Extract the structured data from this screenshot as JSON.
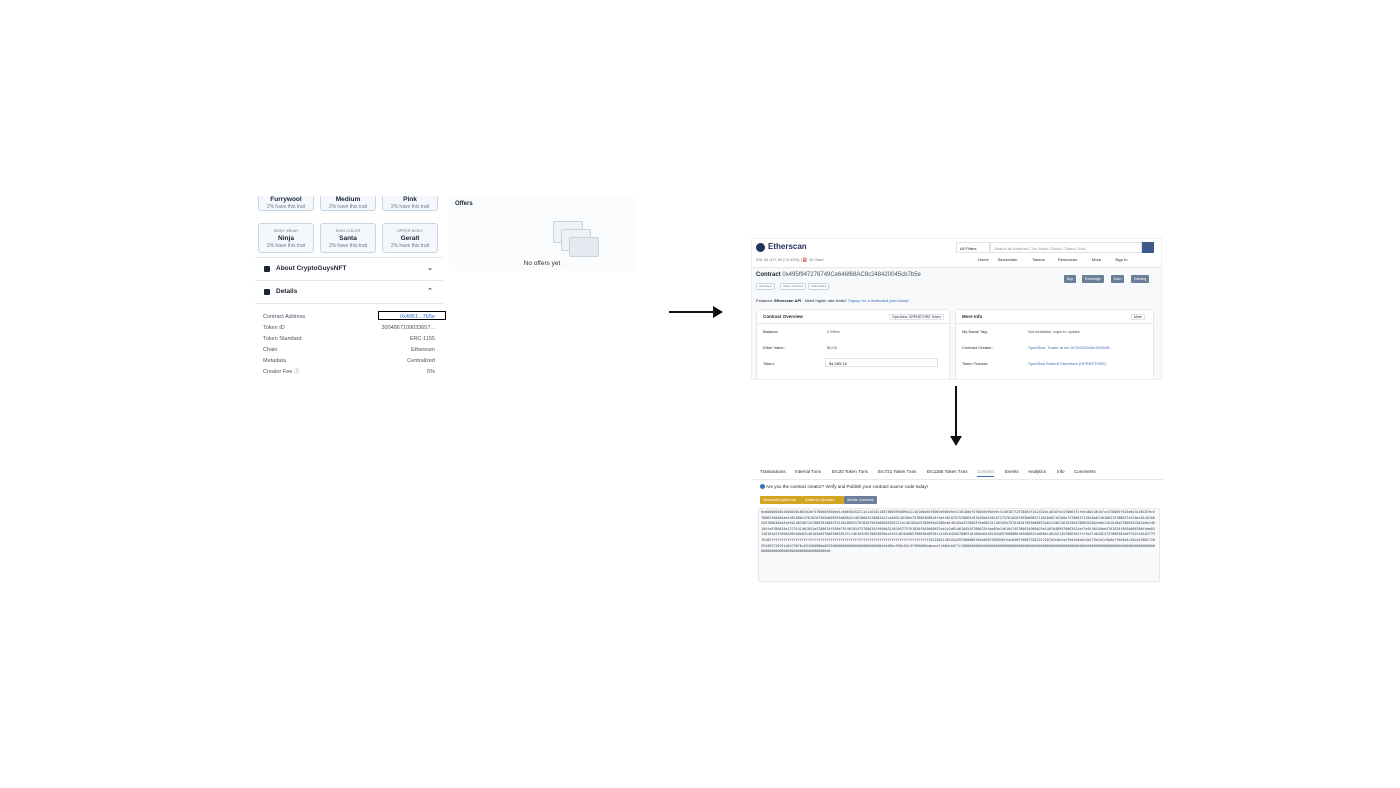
{
  "opensea": {
    "traits_row1": [
      {
        "name": "Furrywool",
        "rarity": "2% have this trait"
      },
      {
        "name": "Medium",
        "rarity": "2% have this trait"
      },
      {
        "name": "Pink",
        "rarity": "2% have this trait"
      }
    ],
    "traits_row2": [
      {
        "type": "BODY WEAR",
        "name": "Ninja",
        "rarity": "2% have this trait"
      },
      {
        "type": "SKIN COLOR",
        "name": "Santa",
        "rarity": "2% have this trait"
      },
      {
        "type": "UPPER BODY",
        "name": "Geralt",
        "rarity": "2% have this trait"
      }
    ],
    "about_label": "About CryptoGuysNFT",
    "details_label": "Details",
    "details": [
      {
        "key": "Contract Address",
        "value": "0x4951...7b5e"
      },
      {
        "key": "Token ID",
        "value": "3004867109033657..."
      },
      {
        "key": "Token Standard",
        "value": "ERC-1155"
      },
      {
        "key": "Chain",
        "value": "Ethereum"
      },
      {
        "key": "Metadata",
        "value": "Centralized"
      },
      {
        "key": "Creator Fee ⓘ",
        "value": "5%"
      }
    ],
    "offers_title": "Offers",
    "no_offers": "No offers yet"
  },
  "etherscan": {
    "logo": "Etherscan",
    "price": "Eth: $1,317.50 (+0.45%) | ⛽ 15 Gwei",
    "filter": "All Filters",
    "search_placeholder": "Search by Address / Txn Hash / Block / Token / Ens",
    "nav": [
      "Home",
      "Blockchain",
      "Tokens",
      "Resources",
      "More",
      "Sign In"
    ],
    "contract_label": "Contract",
    "contract_address": "0x495f947276749Ce646f68AC8c248420045cb7b5e",
    "tags": [
      "OpenSea",
      "Token Contract",
      "Collectibles"
    ],
    "right_buttons": [
      "Buy",
      "Exchange",
      "Earn",
      "Gaming"
    ],
    "featured_label": "Featured:",
    "featured_bold": "Etherscan API",
    "featured_text": " - Need higher rate limits? ",
    "featured_link": "Signup for a dedicated plan today!",
    "overview_title": "Contract Overview",
    "overview_badge": "OpenSea: OPENSTORE Token",
    "balance_label": "Balance:",
    "balance_value": "0 Ether",
    "ether_value_label": "Ether Value:",
    "ether_value": "$0.00",
    "token_label": "Token:",
    "token_value": "$4,085.16",
    "moreinfo_title": "More Info",
    "more_btn": "More",
    "name_tag_label": "My Name Tag:",
    "name_tag_value": "Not Available, login to update",
    "creator_label": "Contract Creator:",
    "creator_value": "OpenSea: Trader at txn 0x7b9312d5e7b53cf5...",
    "tracker_label": "Token Tracker:",
    "tracker_value": "OpenSea Shared Storefront (OPENSTORE)"
  },
  "contract_tab": {
    "tabs": [
      "Transactions",
      "Internal Txns",
      "Erc20 Token Txns",
      "Erc721 Token Txns",
      "Erc1155 Token Txns",
      "Contract",
      "Events",
      "Analytics",
      "Info",
      "Comments"
    ],
    "active_tab": "Contract",
    "verify_text": "Are you the contract creator? Verify and Publish your contract source code today!",
    "buttons": [
      "Decompile ByteCode",
      "Switch to Opcodes View",
      "Similar Contracts"
    ],
    "bytecode": "0x60806040526004361061020f5760003560e01c80636352211e1161011857806395d89b41116100a0578063e985e9c51161006f578063e985e9c514610772578063f242432a146107ac578063f2fde38b146107cc578063f923e8c3146107ec578063fb0b84ae1461080c5761020f565b806395d89b41146106d2578063a22cb465146106e7578063b88d4fde14610707578063c87b56dd146107275761020f565b8063715018a6116100e7578063715018a61461063f5780637e518ec8146106545780638da5cb5b1461067457806391686f53146106925761020f565b80636352211e146105a25780636c0360eb146105d257806370a08231146105e75761020f565b80632eb2c2d61161019b57806342842e0e1161016a57806342842e0e146104fa5780634e1273f41461051a5780634f558e791461054757806355f804b3146105775761020f565b80632eb2c2d6146104545780633f4ba83a146104745780634060b25e14610489578063424ef2e9146104be5761020f565b806306fdde03116101e257806306fdde03146103a6578063081812fc146103c8578063095ea7b3146104005780630e89341c1461042057806318160ddd1461044057600080fd5b8062fdd58e1461021457806301ffc9a71461024757806303a0f7b214610277576102ffffffffffffffffffffffffffffffffffffffffffffffffffffffffffffffffffffffffffffff811681146102a357600080fd5b5091905056fea26469706673582212207b3c8e2a4f9d1e6b0c5a7f3e2d1c9b8a7f6e5d4c3b2a19081726354463728191a64736f6c634300080a0033000000000000000000000000a5409ec958c83c3f309868babaca7c86dcb077c1000000000000000000000000000000000000000000000000000000000000006000000000000000000000000000000000000000000000000000000000000000a0"
  },
  "colors": {
    "etherscan_navy": "#21325b",
    "link_blue": "#3b6fb6",
    "decompile_orange": "#d4a520",
    "similar_gray": "#6b7f99"
  }
}
